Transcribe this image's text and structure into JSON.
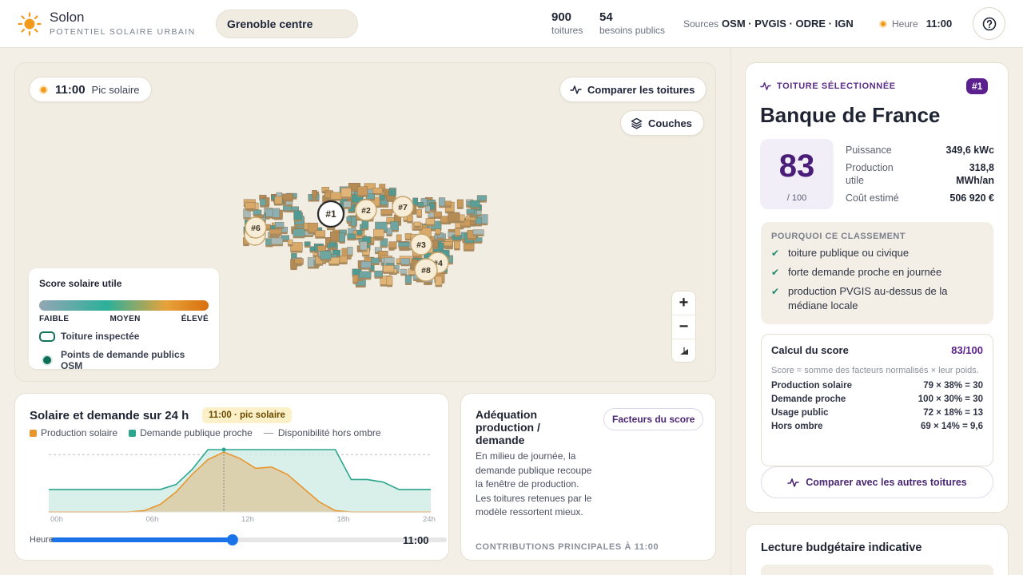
{
  "header": {
    "brand_name": "Solon",
    "brand_sub": "POTENTIEL SOLAIRE URBAIN",
    "city": "Grenoble centre",
    "stats": [
      {
        "value": "900",
        "label": "toitures"
      },
      {
        "value": "54",
        "label": "besoins publics"
      }
    ],
    "sources_label": "Sources",
    "sources": "OSM · PVGIS · ODRE · IGN",
    "hour_label": "Heure",
    "hour_value": "11:00",
    "help_icon": "help-circle-icon"
  },
  "map": {
    "time_value": "11:00",
    "time_label": "Pic solaire",
    "compare_label": "Comparer les toitures",
    "layers_label": "Couches",
    "markers": [
      "#1",
      "#2",
      "#3",
      "#4",
      "#5",
      "#6",
      "#7",
      "#8"
    ],
    "legend": {
      "title": "Score solaire utile",
      "low": "FAIBLE",
      "mid": "MOYEN",
      "high": "ÉLEVÉ",
      "inspected": "Toiture inspectée",
      "demand_points": "Points de demande publics OSM"
    },
    "zoom_in": "+",
    "zoom_out": "−",
    "colors": {
      "roof_low": "#93a6b4",
      "roof_mid": "#2bb09a",
      "roof_high": "#d8700d"
    }
  },
  "chart": {
    "title": "Solaire et demande sur 24 h",
    "badge": "11:00 · pic solaire",
    "legend": {
      "production": "Production solaire",
      "demand": "Demande publique proche",
      "availability": "Disponibilité hors ombre"
    },
    "slider_label": "Heure",
    "slider_value": "11:00"
  },
  "chart_data": {
    "type": "area",
    "x": [
      0,
      1,
      2,
      3,
      4,
      5,
      6,
      7,
      8,
      9,
      10,
      11,
      12,
      13,
      14,
      15,
      16,
      17,
      18,
      19,
      20,
      21,
      22,
      23,
      24
    ],
    "x_ticks": [
      "00h",
      "06h",
      "12h",
      "18h",
      "24h"
    ],
    "series": [
      {
        "name": "Production solaire",
        "color": "#e8962e",
        "values": [
          0,
          0,
          0,
          0,
          0,
          0,
          2,
          12,
          32,
          60,
          84,
          96,
          86,
          70,
          72,
          60,
          38,
          16,
          2,
          0,
          0,
          0,
          0,
          0,
          0
        ]
      },
      {
        "name": "Demande publique proche",
        "color": "#2aa58e",
        "values": [
          36,
          36,
          36,
          36,
          36,
          36,
          36,
          36,
          44,
          68,
          100,
          100,
          100,
          100,
          100,
          100,
          100,
          100,
          100,
          52,
          52,
          48,
          36,
          36,
          36
        ]
      },
      {
        "name": "Disponibilité hors ombre",
        "color": "#9a9a9a",
        "values": [
          92,
          92,
          92,
          92,
          92,
          92,
          92,
          92,
          92,
          92,
          92,
          92,
          92,
          92,
          92,
          92,
          92,
          92,
          92,
          92,
          92,
          92,
          92,
          92,
          92
        ]
      }
    ],
    "current_hour": 11,
    "ylim": [
      0,
      100
    ]
  },
  "adequation": {
    "title": "Adéquation production / demande",
    "button": "Facteurs du score",
    "body": "En milieu de journée, la demande publique recoupe la fenêtre de production. Les toitures retenues par le modèle ressortent mieux.",
    "footer": "CONTRIBUTIONS PRINCIPALES À 11:00"
  },
  "selected": {
    "kicker": "TOITURE SÉLECTIONNÉE",
    "rank": "#1",
    "name": "Banque de France",
    "score": "83",
    "score_den": "/ 100",
    "kv": [
      {
        "k": "Puissance",
        "v": "349,6 kWc"
      },
      {
        "k": "Production utile",
        "v": "318,8 MWh/an"
      },
      {
        "k": "Coût estimé",
        "v": "506 920 €"
      }
    ],
    "why_title": "POURQUOI CE CLASSEMENT",
    "why": [
      "toiture publique ou civique",
      "forte demande proche en journée",
      "production PVGIS au-dessus de la médiane locale"
    ],
    "calc_title": "Calcul du score",
    "calc_value": "83/100",
    "calc_note": "Score = somme des facteurs normalisés × leur poids.",
    "calc_rows": [
      {
        "k": "Production solaire",
        "v": "79 × 38% = 30"
      },
      {
        "k": "Demande proche",
        "v": "100 × 30% = 30"
      },
      {
        "k": "Usage public",
        "v": "72 × 18% = 13"
      },
      {
        "k": "Hors ombre",
        "v": "69 × 14% = 9,6"
      }
    ],
    "compare_button": "Comparer avec les autres toitures"
  },
  "budget": {
    "title": "Lecture budgétaire indicative"
  }
}
